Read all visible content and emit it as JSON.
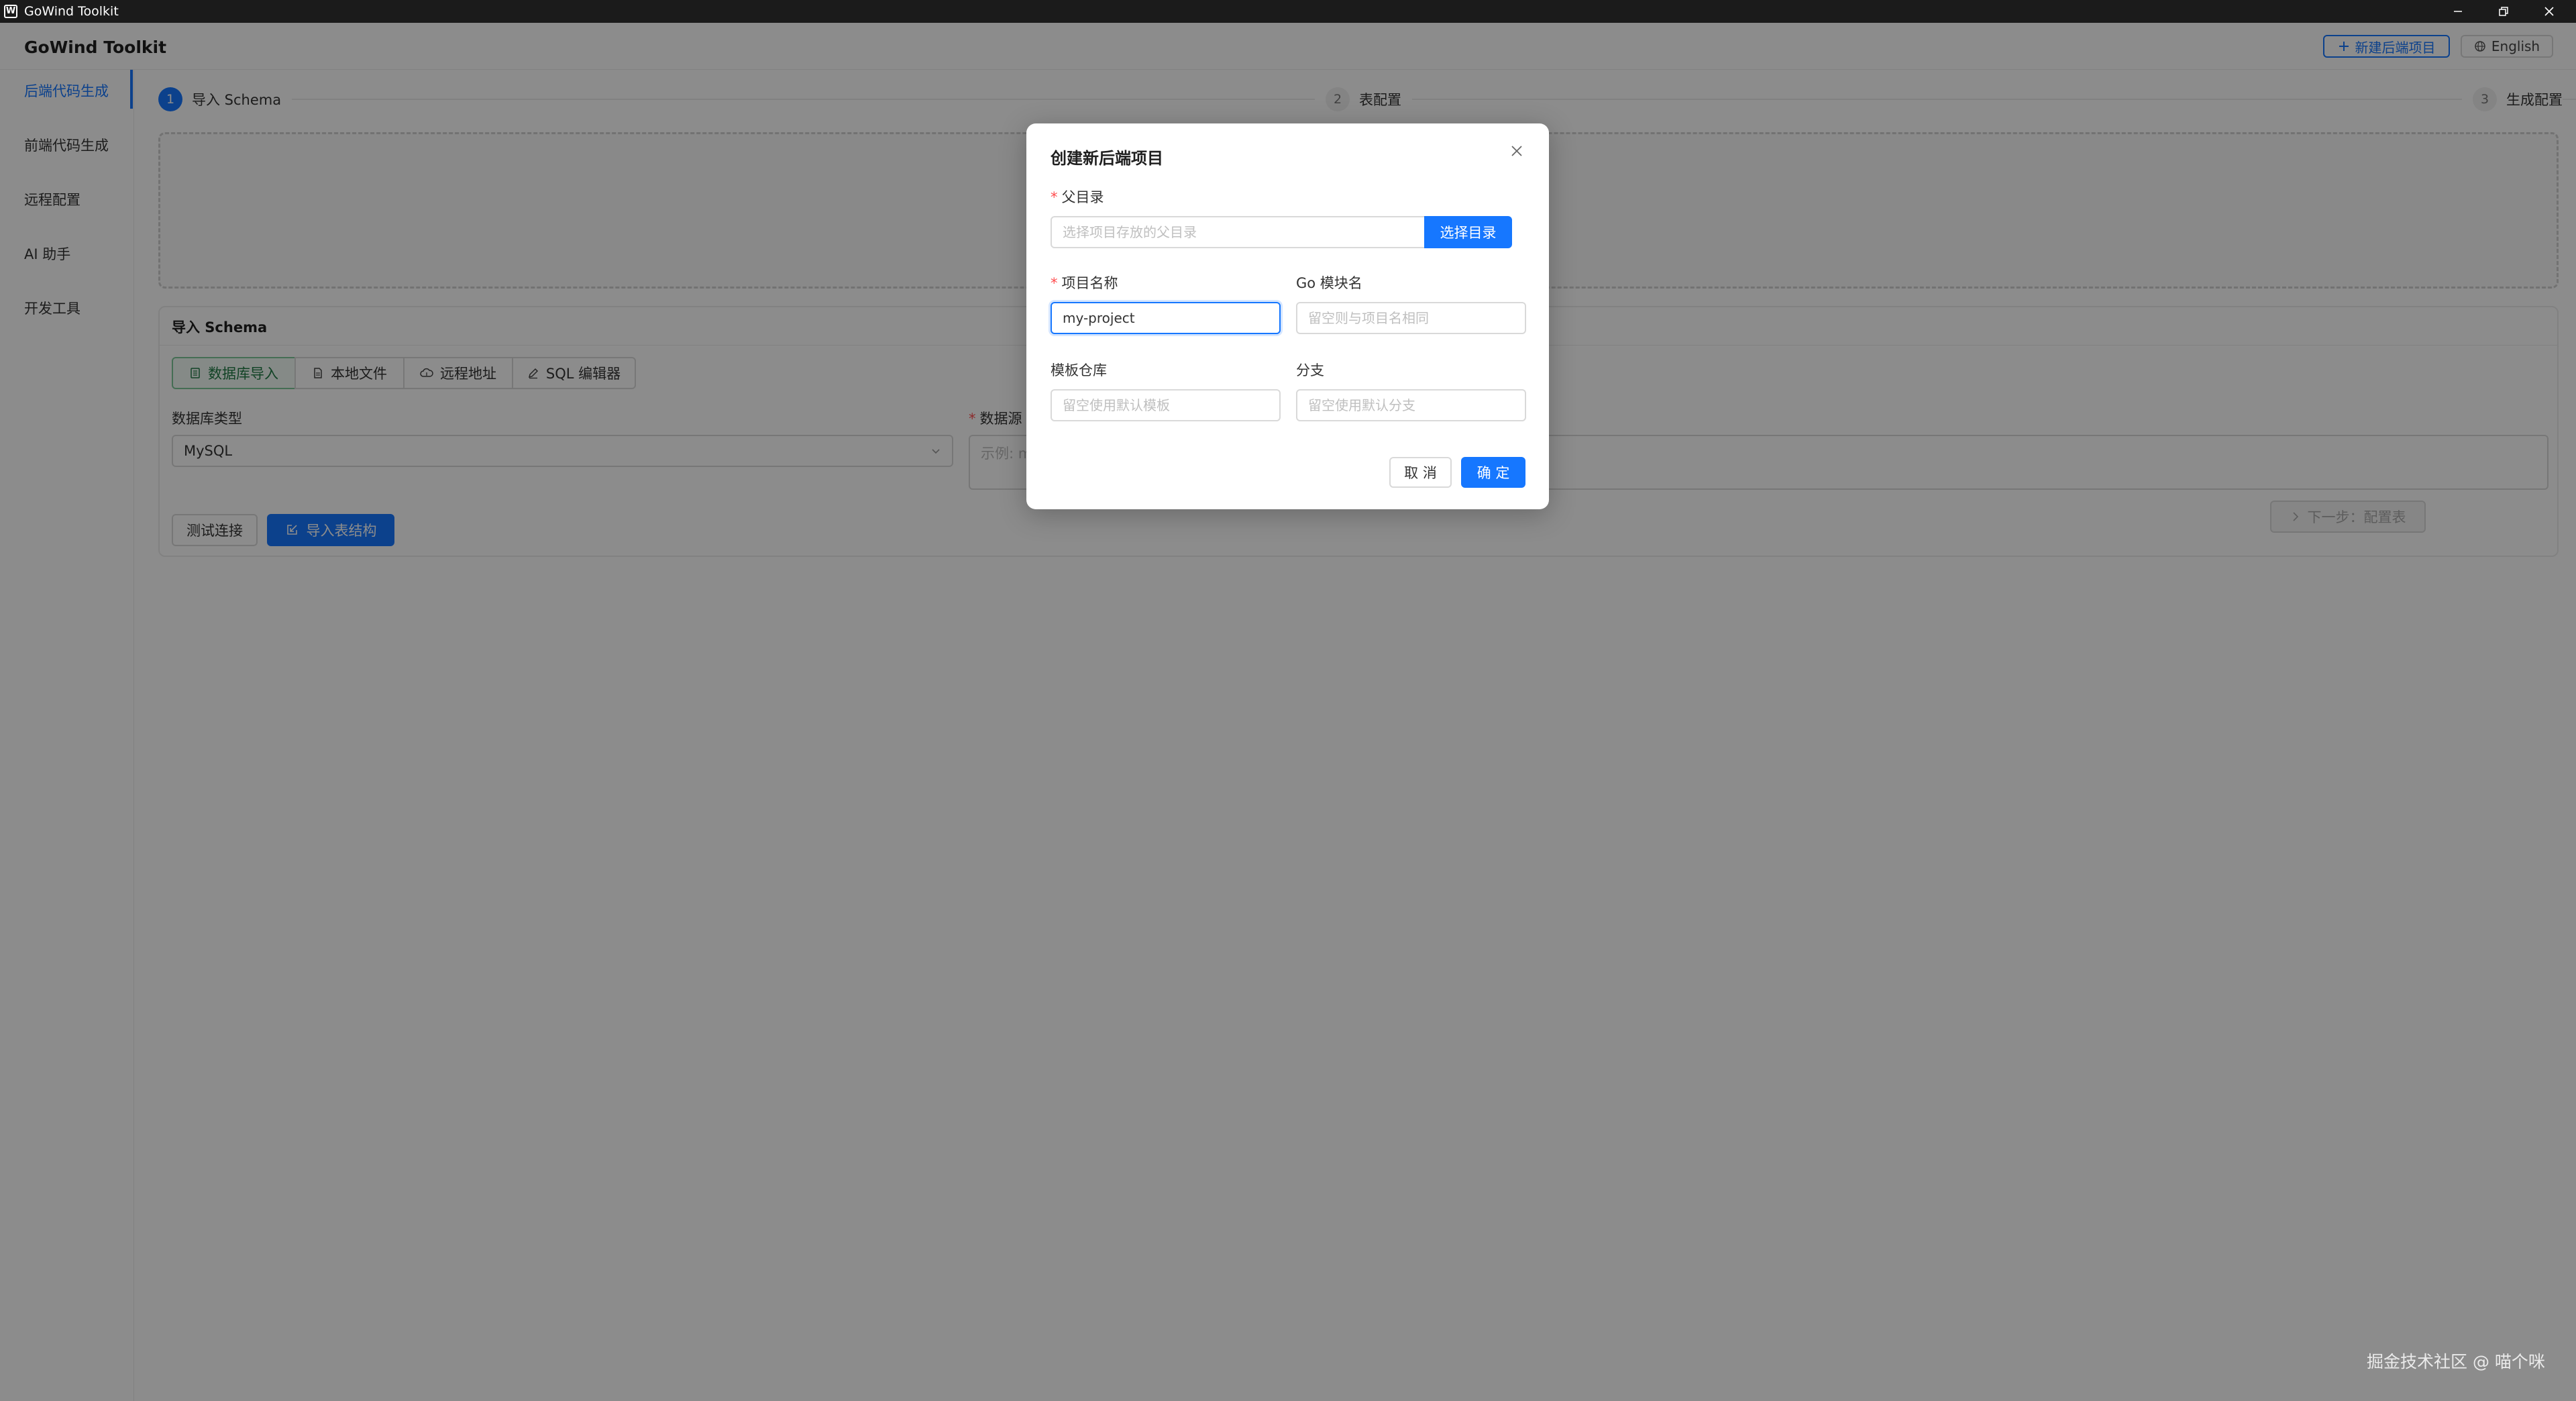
{
  "window": {
    "title": "GoWind Toolkit",
    "app_icon": "W"
  },
  "header": {
    "brand": "GoWind Toolkit",
    "new_project_label": "新建后端项目",
    "language_label": "English"
  },
  "sidebar": {
    "items": [
      {
        "label": "后端代码生成",
        "active": true
      },
      {
        "label": "前端代码生成"
      },
      {
        "label": "远程配置"
      },
      {
        "label": "AI 助手"
      },
      {
        "label": "开发工具"
      }
    ]
  },
  "steps": [
    {
      "num": "1",
      "label": "导入 Schema",
      "active": true
    },
    {
      "num": "2",
      "label": "表配置"
    },
    {
      "num": "3",
      "label": "生成配置"
    }
  ],
  "import_card": {
    "title": "导入 Schema",
    "tabs": [
      {
        "label": "数据库导入",
        "icon": "database-icon",
        "active": true
      },
      {
        "label": "本地文件",
        "icon": "file-icon"
      },
      {
        "label": "远程地址",
        "icon": "cloud-icon"
      },
      {
        "label": "SQL 编辑器",
        "icon": "edit-icon"
      }
    ],
    "db_type_label": "数据库类型",
    "db_type_value": "MySQL",
    "dsn_label": "数据源",
    "dsn_placeholder": "示例: m",
    "test_label": "测试连接",
    "import_label": "导入表结构"
  },
  "next_label": "下一步：配置表",
  "modal": {
    "title": "创建新后端项目",
    "parent_dir_label": "父目录",
    "parent_dir_placeholder": "选择项目存放的父目录",
    "choose_dir_label": "选择目录",
    "project_name_label": "项目名称",
    "project_name_value": "my-project",
    "go_module_label": "Go 模块名",
    "go_module_placeholder": "留空则与项目名相同",
    "template_repo_label": "模板仓库",
    "template_repo_placeholder": "留空使用默认模板",
    "branch_label": "分支",
    "branch_placeholder": "留空使用默认分支",
    "cancel_label": "取 消",
    "ok_label": "确 定"
  },
  "watermark": "掘金技术社区 @ 喵个咪",
  "colors": {
    "primary": "#1677ff",
    "active_tab": "#1f7a44",
    "required": "#ff4d4f"
  }
}
